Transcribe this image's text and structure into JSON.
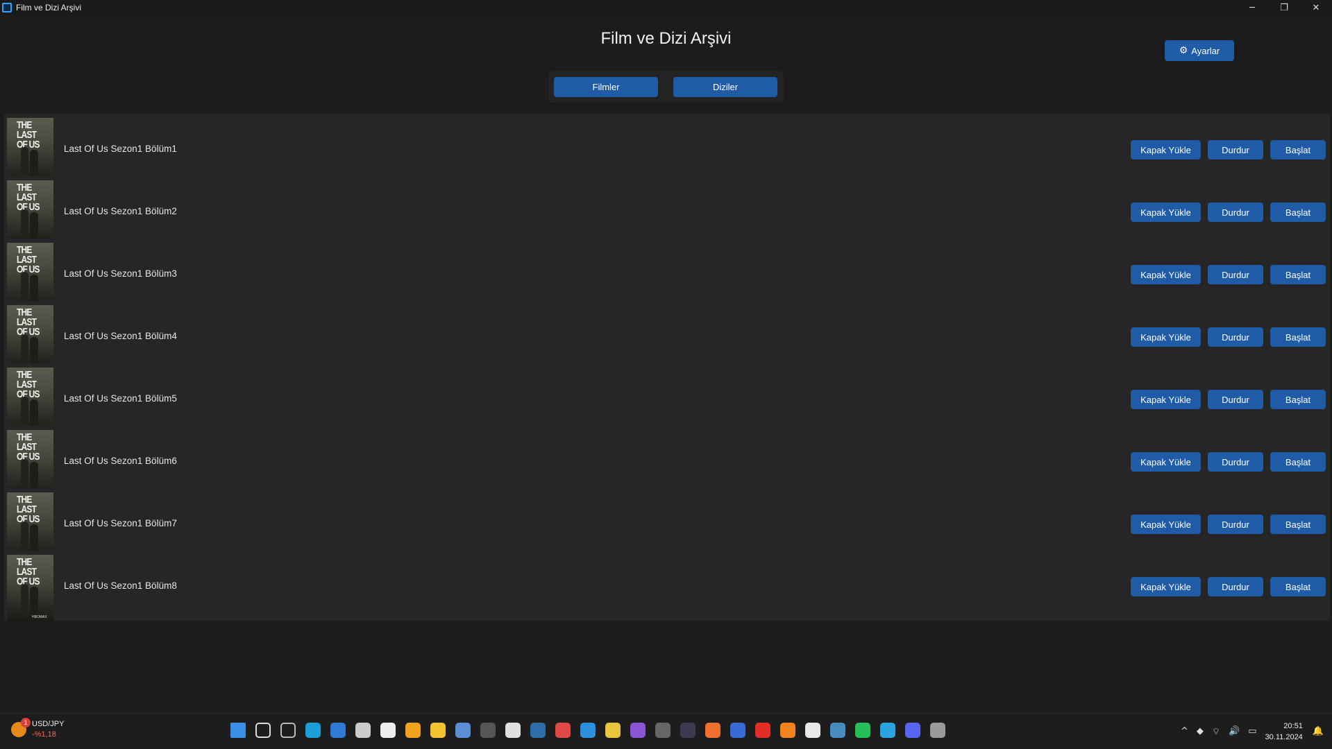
{
  "window": {
    "title": "Film ve Dizi Arşivi",
    "controls": [
      "─",
      "❐",
      "✕"
    ]
  },
  "header": {
    "title": "Film ve Dizi Arşivi",
    "settings_label": "Ayarlar",
    "settings_icon": "gear-icon"
  },
  "tabs": [
    {
      "label": "Filmler"
    },
    {
      "label": "Diziler"
    }
  ],
  "actions": {
    "cover": "Kapak Yükle",
    "stop": "Durdur",
    "start": "Başlat"
  },
  "poster": {
    "title_line1": "THE",
    "title_line2": "LAST",
    "title_line3": "OF US",
    "brand": "HBOMAX"
  },
  "items": [
    {
      "title": "Last Of Us Sezon1 Bölüm1"
    },
    {
      "title": "Last Of Us Sezon1 Bölüm2"
    },
    {
      "title": "Last Of Us Sezon1 Bölüm3"
    },
    {
      "title": "Last Of Us Sezon1 Bölüm4"
    },
    {
      "title": "Last Of Us Sezon1 Bölüm5"
    },
    {
      "title": "Last Of Us Sezon1 Bölüm6"
    },
    {
      "title": "Last Of Us Sezon1 Bölüm7"
    },
    {
      "title": "Last Of Us Sezon1 Bölüm8"
    }
  ],
  "taskbar": {
    "widget": {
      "name": "USD/JPY",
      "change": "-%1,18",
      "badge": "1"
    },
    "apps": [
      {
        "name": "windows-start-icon",
        "color": "#3a8ee6"
      },
      {
        "name": "search-icon",
        "color": "#dddddd"
      },
      {
        "name": "task-view-icon",
        "color": "#bbbbbb"
      },
      {
        "name": "edge-icon",
        "color": "#1b9fd8"
      },
      {
        "name": "browser-icon",
        "color": "#2e7bd6"
      },
      {
        "name": "app-icon",
        "color": "#cccccc"
      },
      {
        "name": "zed-icon",
        "color": "#eeeeee"
      },
      {
        "name": "weather-icon",
        "color": "#f0a21c"
      },
      {
        "name": "file-explorer-icon",
        "color": "#f4c430"
      },
      {
        "name": "qbittorrent-icon",
        "color": "#5c8fd6"
      },
      {
        "name": "epic-games-icon",
        "color": "#555555"
      },
      {
        "name": "store-icon",
        "color": "#e0e0e0"
      },
      {
        "name": "steam-icon",
        "color": "#2d6ea8"
      },
      {
        "name": "game-icon",
        "color": "#e04848"
      },
      {
        "name": "vscode-icon",
        "color": "#2b8fdc"
      },
      {
        "name": "python-icon",
        "color": "#e8c53c"
      },
      {
        "name": "clipchamp-icon",
        "color": "#8b54d6"
      },
      {
        "name": "obs-icon",
        "color": "#666666"
      },
      {
        "name": "davinci-icon",
        "color": "#3a3a50"
      },
      {
        "name": "xampp-icon",
        "color": "#f07030"
      },
      {
        "name": "connect-icon",
        "color": "#3a6ad6"
      },
      {
        "name": "youtube-icon",
        "color": "#e52d27"
      },
      {
        "name": "blender-icon",
        "color": "#f0831e"
      },
      {
        "name": "unreal-icon",
        "color": "#e8e8e8"
      },
      {
        "name": "godot-icon",
        "color": "#478cbf"
      },
      {
        "name": "whatsapp-icon",
        "color": "#25c05a"
      },
      {
        "name": "telegram-icon",
        "color": "#2aa3e0"
      },
      {
        "name": "discord-icon",
        "color": "#5865f2"
      },
      {
        "name": "settings-icon",
        "color": "#9a9a9a"
      }
    ],
    "tray_icons": [
      "^",
      "◆",
      "⌔",
      "🔊",
      "▭"
    ],
    "time": "20:51",
    "date": "30.11.2024"
  }
}
